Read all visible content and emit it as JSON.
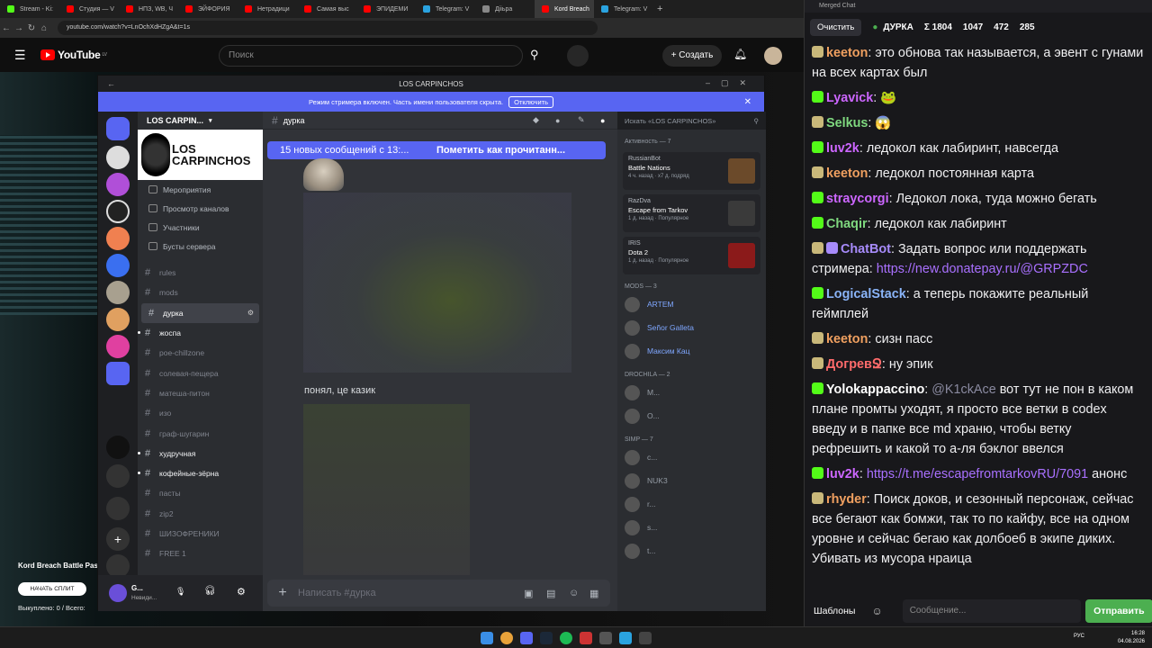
{
  "browser": {
    "tabs": [
      "Stream - Ki:",
      "Студия — V",
      "НПЗ, WB, Ч",
      "ЭЙФОРИЯ",
      "Нетрадици",
      "Самая выс",
      "ЭПИДЕМИ",
      "Telegram: V",
      "Дiiьра",
      "Kord Breach",
      "Telegram: V"
    ],
    "url": "youtube.com/watch?v=LnOchXdHZgA&t=1s"
  },
  "youtube": {
    "logo": "YouTube",
    "logo_region": "LV",
    "search_placeholder": "Поиск",
    "create_label": "+ Создать"
  },
  "video_overlay": {
    "title": "Kord Breach Battle Pas",
    "split_button": "НАЧАТЬ СПЛИТ",
    "bought": "Выкуплено: 0 / Всего:"
  },
  "discord": {
    "window_title": "LOS CARPINCHOS",
    "streamer_notice": "Режим стримера включен. Часть имени пользователя скрыта.",
    "streamer_disable": "Отключить",
    "guild_name": "LOS CARPIN...",
    "banner_text": "LOS CARPINCHOS",
    "menu": [
      "Мероприятия",
      "Просмотр каналов",
      "Участники",
      "Бусты сервера"
    ],
    "channels": [
      {
        "name": "rules",
        "bold": false
      },
      {
        "name": "mods",
        "bold": false
      },
      {
        "name": "дурка",
        "bold": true,
        "selected": true
      },
      {
        "name": "жоспа",
        "bold": true
      },
      {
        "name": "poe-chillzone",
        "bold": false
      },
      {
        "name": "солевая-пещера",
        "bold": false
      },
      {
        "name": "матеша-питон",
        "bold": false
      },
      {
        "name": "изо",
        "bold": false
      },
      {
        "name": "граф-шугарин",
        "bold": false
      },
      {
        "name": "худручная",
        "bold": true
      },
      {
        "name": "кофейные-зёрна",
        "bold": true
      },
      {
        "name": "пасты",
        "bold": false
      },
      {
        "name": "zip2",
        "bold": false
      },
      {
        "name": "ШИЗОФРЕНИКИ",
        "bold": false
      },
      {
        "name": "FREE 1",
        "bold": false
      }
    ],
    "user": {
      "name": "G...",
      "status": "Невиди..."
    },
    "chat": {
      "channel": "дурка",
      "new_messages": "15 новых сообщений с 13:...",
      "mark_read": "Пометить как прочитанн...",
      "message": "понял, це казик",
      "composer_placeholder": "Написать #дурка"
    },
    "members": {
      "search_placeholder": "Искать «LOS CARPINCHOS»",
      "activity_header": "Активность — 7",
      "activities": [
        {
          "user": "RussianBot",
          "game": "Battle Nations",
          "meta": "4 ч. назад · x7 д. подряд"
        },
        {
          "user": "RazDva",
          "game": "Escape from Tarkov",
          "meta": "1 д. назад · Популярное"
        },
        {
          "user": "IRIS",
          "game": "Dota 2",
          "meta": "1 д. назад · Популярное"
        }
      ],
      "mods_header": "MODS — 3",
      "mods": [
        "ARTEM",
        "Señor Galleta",
        "Максим Кац"
      ],
      "drochila_header": "DROCHILA — 2",
      "drochila": [
        "M...",
        "O..."
      ],
      "simp_header": "SIMP — 7",
      "simp": [
        "c...",
        "NUK3",
        "r...",
        "s...",
        "t..."
      ]
    }
  },
  "stream_chat": {
    "window_title": "Merged Chat",
    "clear_label": "Очистить",
    "channel": "ДУРКА",
    "stats": [
      "Σ 1804",
      "1047",
      "472",
      "285"
    ],
    "messages": [
      {
        "nick": "keeton",
        "color": "#f0a060",
        "text": "это обнова так называется, а эвент с гунами на всех картах был"
      },
      {
        "nick": "Lyavick",
        "color": "#cc66ff",
        "text": ""
      },
      {
        "nick": "Selkus",
        "color": "#7fd87f",
        "text": ""
      },
      {
        "nick": "luv2k",
        "color": "#cc66ff",
        "text": "ледокол как лабиринт, навсегда"
      },
      {
        "nick": "keeton",
        "color": "#f0a060",
        "text": "ледокол постоянная карта"
      },
      {
        "nick": "straycorgi",
        "color": "#cc66ff",
        "text": "Ледокол лока, туда можно бегать"
      },
      {
        "nick": "Chaqir",
        "color": "#7fd87f",
        "text": "ледокол как лабиринт"
      },
      {
        "nick": "ChatBot",
        "color": "#a78bfa",
        "text": "Задать вопрос или поддержать стримера:",
        "link": "https://new.donatepay.ru/@GRPZDC"
      },
      {
        "nick": "LogicalStack",
        "color": "#8ab4f8",
        "text": "а теперь покажите реальный геймплей"
      },
      {
        "nick": "keeton",
        "color": "#f0a060",
        "text": "сизн пасс"
      },
      {
        "nick": "ДогревՋ",
        "color": "#ff6b6b",
        "text": "ну эпик"
      },
      {
        "nick": "Yolokappaccino",
        "color": "#ffffff",
        "text": "вот тут не пон в каком плане промты уходят, я просто все ветки в codex введу и в папке все md храню, чтобы ветку рефрешить и какой то а-ля бэклог ввелся",
        "mention": "@K1ckAce"
      },
      {
        "nick": "luv2k",
        "color": "#cc66ff",
        "text": "анонс",
        "link": "https://t.me/escapefromtarkovRU/7091"
      },
      {
        "nick": "rhyder",
        "color": "#f0a060",
        "text": "Поиск доков, и сезонный персонаж, сейчас все бегают как бомжи, так то по кайфу, все на одном уровне и сейчас бегаю как долбоеб в экипе диких. Убивать из мусора нраица"
      }
    ],
    "templates_label": "Шаблоны",
    "input_placeholder": "Сообщение...",
    "send_label": "Отправить"
  },
  "taskbar": {
    "lang": "РУС",
    "time": "16:28",
    "date": "04.08.2026"
  }
}
